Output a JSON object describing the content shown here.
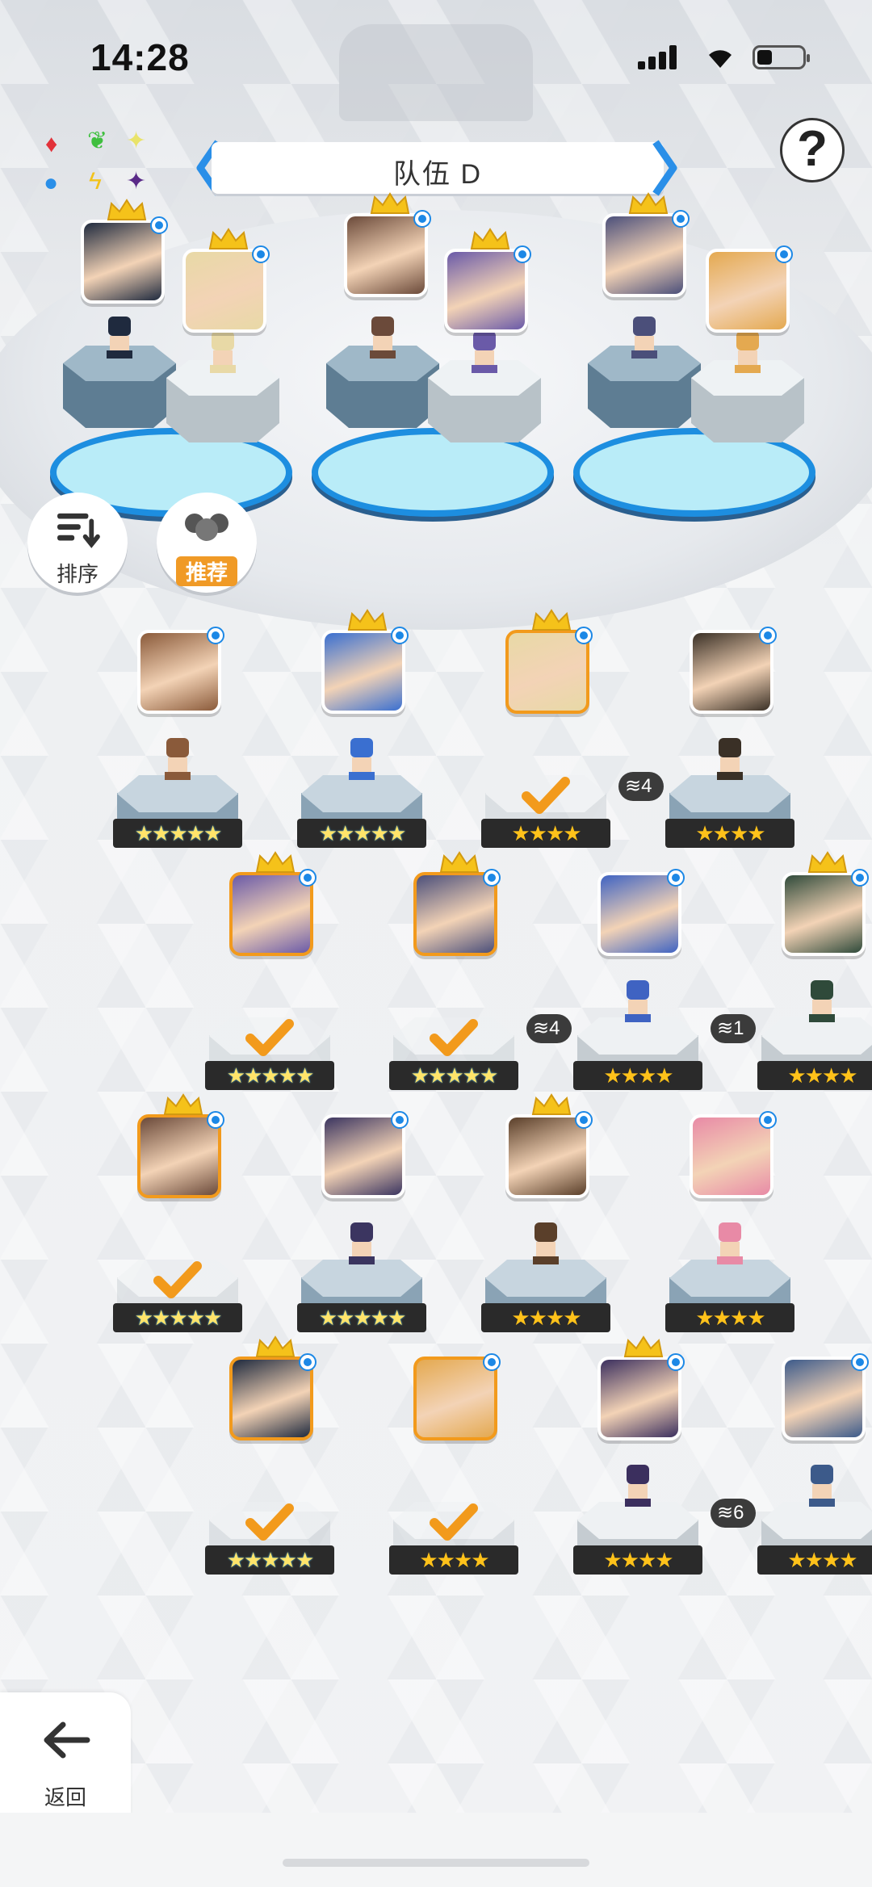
{
  "status_bar": {
    "time": "14:28"
  },
  "team": {
    "title": "队伍 D"
  },
  "help_label": "?",
  "buttons": {
    "sort": "排序",
    "recommend": "推荐",
    "back": "返回"
  },
  "colors": {
    "accent": "#f29a1c",
    "water": "#1d8ee0",
    "element_dot": "#1c88e6"
  },
  "elements": [
    "fire-icon",
    "wind-icon",
    "light-icon",
    "water-icon",
    "lightning-icon",
    "dark-icon"
  ],
  "team_slots": [
    {
      "slot": 1,
      "leader": true,
      "portrait_color": "#1f2a3e"
    },
    {
      "slot": 2,
      "leader": true,
      "portrait_color": "#e8d9a6"
    },
    {
      "slot": 3,
      "leader": true,
      "portrait_color": "#6b4a3a"
    },
    {
      "slot": 4,
      "leader": true,
      "portrait_color": "#6a5aa8"
    },
    {
      "slot": 5,
      "leader": true,
      "portrait_color": "#4b4f7a"
    },
    {
      "slot": 6,
      "leader": false,
      "portrait_color": "#e4a950"
    }
  ],
  "roster": [
    {
      "stars": "★★★★★",
      "rainbow": true,
      "crown": false,
      "selected": false,
      "checked": false,
      "dupe": "",
      "color": "#8a5a3a"
    },
    {
      "stars": "★★★★★",
      "rainbow": true,
      "crown": true,
      "selected": false,
      "checked": false,
      "dupe": "",
      "color": "#3a6fd0"
    },
    {
      "stars": "★★★★",
      "rainbow": false,
      "crown": true,
      "selected": true,
      "checked": true,
      "dupe": "",
      "color": "#e8d9a6"
    },
    {
      "stars": "★★★★",
      "rainbow": false,
      "crown": false,
      "selected": false,
      "checked": false,
      "dupe": "4",
      "color": "#3a3026"
    },
    {
      "stars": "★★★★★",
      "rainbow": true,
      "crown": true,
      "selected": true,
      "checked": true,
      "dupe": "",
      "color": "#6a5aa8"
    },
    {
      "stars": "★★★★★",
      "rainbow": true,
      "crown": true,
      "selected": true,
      "checked": true,
      "dupe": "",
      "color": "#4b4f7a"
    },
    {
      "stars": "★★★★",
      "rainbow": false,
      "crown": false,
      "selected": false,
      "checked": false,
      "dupe": "4",
      "color": "#3f63c2"
    },
    {
      "stars": "★★★★",
      "rainbow": false,
      "crown": true,
      "selected": false,
      "checked": false,
      "dupe": "1",
      "color": "#2f4a3a"
    },
    {
      "stars": "★★★★★",
      "rainbow": true,
      "crown": true,
      "selected": true,
      "checked": true,
      "dupe": "",
      "color": "#6b4a3a"
    },
    {
      "stars": "★★★★★",
      "rainbow": true,
      "crown": false,
      "selected": false,
      "checked": false,
      "dupe": "",
      "color": "#3b3560"
    },
    {
      "stars": "★★★★",
      "rainbow": false,
      "crown": true,
      "selected": false,
      "checked": false,
      "dupe": "",
      "color": "#5a3f2a"
    },
    {
      "stars": "★★★★",
      "rainbow": false,
      "crown": false,
      "selected": false,
      "checked": false,
      "dupe": "",
      "color": "#e88aa6"
    },
    {
      "stars": "★★★★★",
      "rainbow": true,
      "crown": true,
      "selected": true,
      "checked": true,
      "dupe": "",
      "color": "#1f2a3e"
    },
    {
      "stars": "★★★★",
      "rainbow": false,
      "crown": false,
      "selected": true,
      "checked": true,
      "dupe": "",
      "color": "#e4a950"
    },
    {
      "stars": "★★★★",
      "rainbow": false,
      "crown": true,
      "selected": false,
      "checked": false,
      "dupe": "",
      "color": "#3b2f5e"
    },
    {
      "stars": "★★★★",
      "rainbow": false,
      "crown": false,
      "selected": false,
      "checked": false,
      "dupe": "6",
      "color": "#3c5a8a"
    }
  ]
}
